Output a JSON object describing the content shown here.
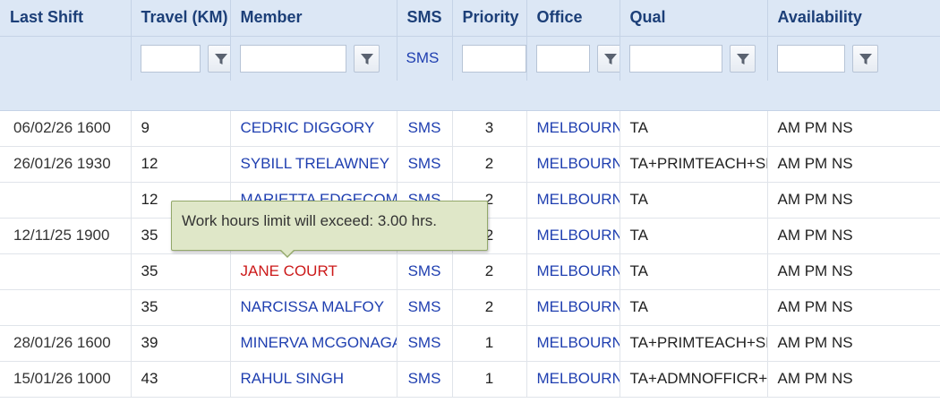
{
  "columns": {
    "last_shift": "Last Shift",
    "travel": "Travel (KM)",
    "member": "Member",
    "sms": "SMS",
    "priority": "Priority",
    "office": "Office",
    "qual": "Qual",
    "availability": "Availability"
  },
  "filters": {
    "travel": "",
    "member": "",
    "sms_link": "SMS",
    "priority": "",
    "office": "",
    "qual": "",
    "availability": ""
  },
  "rows": [
    {
      "last_shift": "06/02/26 1600",
      "travel": "9",
      "member": "CEDRIC DIGGORY",
      "sms": "SMS",
      "priority": "3",
      "office": "MELBOURNE",
      "qual": "TA",
      "availability": "AM PM NS"
    },
    {
      "last_shift": "26/01/26 1930",
      "travel": "12",
      "member": "SYBILL TRELAWNEY",
      "sms": "SMS",
      "priority": "2",
      "office": "MELBOURNE",
      "qual": "TA+PRIMTEACH+SEN",
      "availability": "AM PM NS"
    },
    {
      "last_shift": "",
      "travel": "12",
      "member": "MARIETTA EDGECOMBE",
      "sms": "SMS",
      "priority": "2",
      "office": "MELBOURNE",
      "qual": "TA",
      "availability": "AM PM NS"
    },
    {
      "last_shift": "12/11/25 1900",
      "travel": "35",
      "member": "",
      "sms": "",
      "priority": "2",
      "office": "MELBOURNE",
      "qual": "TA",
      "availability": "AM PM NS"
    },
    {
      "last_shift": "",
      "travel": "35",
      "member": "JANE COURT",
      "sms": "SMS",
      "priority": "2",
      "office": "MELBOURNE",
      "qual": "TA",
      "availability": "AM PM NS",
      "alert": true
    },
    {
      "last_shift": "",
      "travel": "35",
      "member": "NARCISSA MALFOY",
      "sms": "SMS",
      "priority": "2",
      "office": "MELBOURNE",
      "qual": "TA",
      "availability": "AM PM NS"
    },
    {
      "last_shift": "28/01/26 1600",
      "travel": "39",
      "member": "MINERVA MCGONAGALL",
      "sms": "SMS",
      "priority": "1",
      "office": "MELBOURNE",
      "qual": "TA+PRIMTEACH+SEN",
      "availability": "AM PM NS"
    },
    {
      "last_shift": "15/01/26 1000",
      "travel": "43",
      "member": "RAHUL SINGH",
      "sms": "SMS",
      "priority": "1",
      "office": "MELBOURNE",
      "qual": "TA+ADMNOFFICR+",
      "availability": "AM PM NS"
    }
  ],
  "tooltip": {
    "text": "Work hours limit will exceed: 3.00 hrs."
  },
  "icons": {
    "filter": "funnel-icon"
  },
  "colors": {
    "header_bg": "#dce7f5",
    "header_text": "#1c3f78",
    "link": "#1f3fb0",
    "alert": "#cc1a1a",
    "tooltip_bg": "#dfe7c8"
  }
}
